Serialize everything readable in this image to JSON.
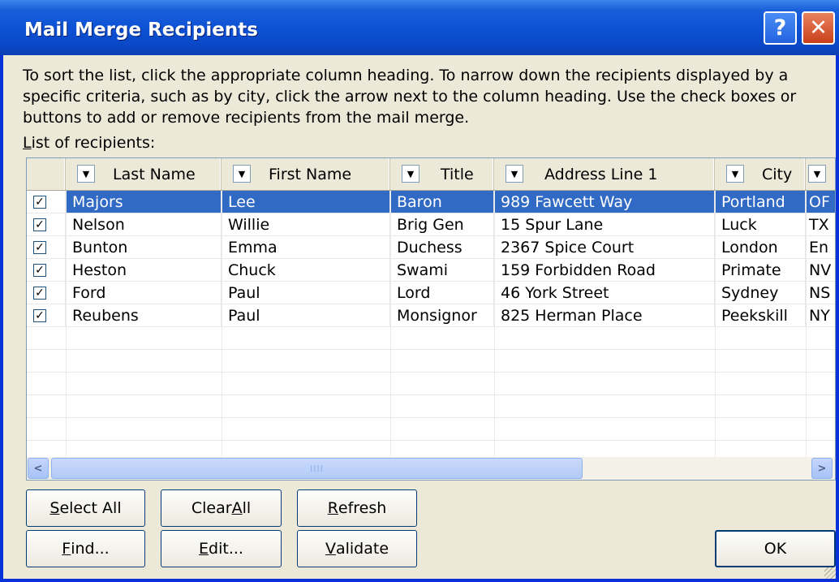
{
  "window": {
    "title": "Mail Merge Recipients",
    "help_label": "?",
    "close_label": "✕"
  },
  "instructions": "To sort the list, click the appropriate column heading.  To narrow down the recipients displayed by a specific criteria, such as by city, click the arrow next to the column heading.  Use the check boxes or buttons to add or remove recipients from the mail merge.",
  "list_label": {
    "accel": "L",
    "rest": "ist of recipients:"
  },
  "columns": [
    {
      "key": "last_name",
      "label": "Last Name",
      "dropdown_icon": "triangle-down"
    },
    {
      "key": "first_name",
      "label": "First Name",
      "dropdown_icon": "triangle-down"
    },
    {
      "key": "title",
      "label": "Title",
      "dropdown_icon": "triangle-down"
    },
    {
      "key": "address1",
      "label": "Address Line 1",
      "dropdown_icon": "triangle-down"
    },
    {
      "key": "city",
      "label": "City",
      "dropdown_icon": "triangle-down"
    },
    {
      "key": "state",
      "label": "",
      "dropdown_icon": "triangle-down"
    }
  ],
  "rows": [
    {
      "checked": true,
      "selected": true,
      "last_name": "Majors",
      "first_name": "Lee",
      "title": "Baron",
      "address1": "989 Fawcett Way",
      "city": "Portland",
      "state": "OF"
    },
    {
      "checked": true,
      "selected": false,
      "last_name": "Nelson",
      "first_name": "Willie",
      "title": "Brig Gen",
      "address1": "15 Spur Lane",
      "city": "Luck",
      "state": "TX"
    },
    {
      "checked": true,
      "selected": false,
      "last_name": "Bunton",
      "first_name": "Emma",
      "title": "Duchess",
      "address1": "2367 Spice Court",
      "city": "London",
      "state": "En"
    },
    {
      "checked": true,
      "selected": false,
      "last_name": "Heston",
      "first_name": "Chuck",
      "title": "Swami",
      "address1": "159 Forbidden Road",
      "city": "Primate",
      "state": "NV"
    },
    {
      "checked": true,
      "selected": false,
      "last_name": "Ford",
      "first_name": "Paul",
      "title": "Lord",
      "address1": "46 York Street",
      "city": "Sydney",
      "state": "NS"
    },
    {
      "checked": true,
      "selected": false,
      "last_name": "Reubens",
      "first_name": "Paul",
      "title": "Monsignor",
      "address1": "825 Herman Place",
      "city": "Peekskill",
      "state": "NY"
    }
  ],
  "scrollbar": {
    "left_arrow": "<",
    "right_arrow": ">",
    "thumb_grip": "IIII"
  },
  "buttons": {
    "select_all": {
      "accel": "S",
      "rest": "elect All"
    },
    "clear_all": {
      "pre": "Clear ",
      "accel": "A",
      "rest": "ll"
    },
    "refresh": {
      "accel": "R",
      "rest": "efresh"
    },
    "find": {
      "accel": "F",
      "rest": "ind..."
    },
    "edit": {
      "accel": "E",
      "rest": "dit..."
    },
    "validate": {
      "accel": "V",
      "rest": "alidate"
    },
    "ok": "OK"
  },
  "colors": {
    "titlebar": "#0d52d6",
    "dialog_bg": "#ece9d8",
    "selection": "#316ac5"
  }
}
